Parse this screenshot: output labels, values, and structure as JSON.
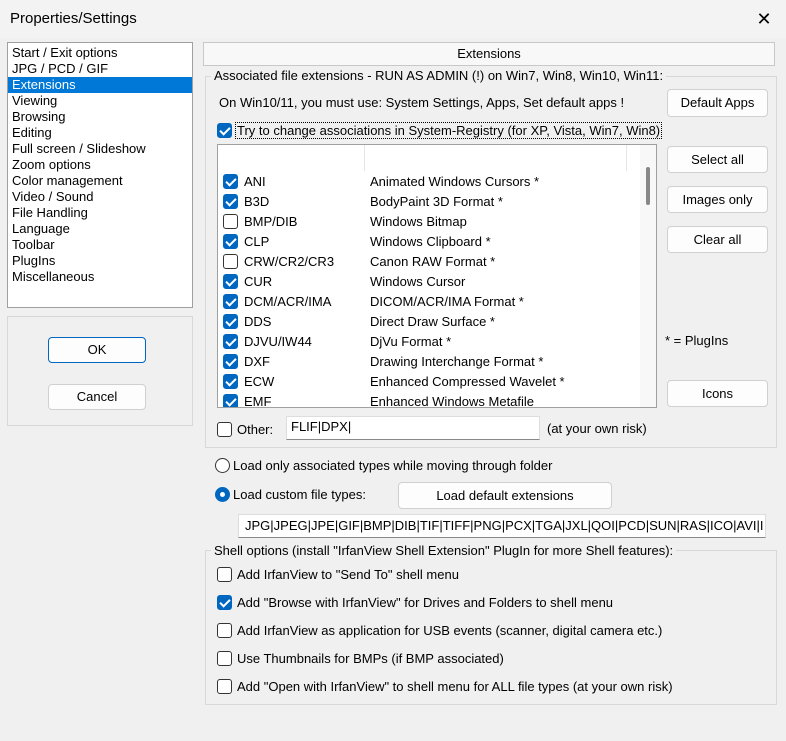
{
  "window": {
    "title": "Properties/Settings",
    "close_icon": "close-icon"
  },
  "sidebar": {
    "items": [
      "Start / Exit options",
      "JPG / PCD / GIF",
      "Extensions",
      "Viewing",
      "Browsing",
      "Editing",
      "Full screen / Slideshow",
      "Zoom options",
      "Color management",
      "Video / Sound",
      "File Handling",
      "Language",
      "Toolbar",
      "PlugIns",
      "Miscellaneous"
    ],
    "selected": "Extensions"
  },
  "buttons": {
    "ok": "OK",
    "cancel": "Cancel",
    "default_apps": "Default Apps",
    "select_all": "Select all",
    "images_only": "Images only",
    "clear_all": "Clear all",
    "icons": "Icons",
    "load_default": "Load default extensions"
  },
  "tab": {
    "title": "Extensions"
  },
  "assoc": {
    "group_label": "Associated file extensions - RUN AS ADMIN (!) on Win7, Win8, Win10, Win11:",
    "note": "On Win10/11, you must use: System Settings, Apps, Set default apps !",
    "registry_label": "Try to change associations in System-Registry (for XP, Vista, Win7, Win8)",
    "registry_checked": true,
    "extensions": [
      {
        "ext": "ANI",
        "desc": "Animated Windows Cursors *",
        "checked": true
      },
      {
        "ext": "B3D",
        "desc": "BodyPaint 3D Format *",
        "checked": true
      },
      {
        "ext": "BMP/DIB",
        "desc": "Windows Bitmap",
        "checked": false
      },
      {
        "ext": "CLP",
        "desc": "Windows Clipboard *",
        "checked": true
      },
      {
        "ext": "CRW/CR2/CR3",
        "desc": "Canon RAW Format *",
        "checked": false
      },
      {
        "ext": "CUR",
        "desc": "Windows Cursor",
        "checked": true
      },
      {
        "ext": "DCM/ACR/IMA",
        "desc": "DICOM/ACR/IMA Format *",
        "checked": true
      },
      {
        "ext": "DDS",
        "desc": "Direct Draw Surface *",
        "checked": true
      },
      {
        "ext": "DJVU/IW44",
        "desc": "DjVu Format *",
        "checked": true
      },
      {
        "ext": "DXF",
        "desc": "Drawing Interchange Format *",
        "checked": true
      },
      {
        "ext": "ECW",
        "desc": "Enhanced Compressed Wavelet *",
        "checked": true
      },
      {
        "ext": "EMF",
        "desc": "Enhanced Windows Metafile",
        "checked": true
      }
    ],
    "plugins_note": "* = PlugIns",
    "other_label": "Other:",
    "other_checked": false,
    "other_value": "FLIF|DPX|",
    "other_note": "(at your own risk)"
  },
  "load": {
    "option1": "Load only associated types while moving through folder",
    "option2": "Load custom file types:",
    "selected": 2,
    "custom_value": "JPG|JPEG|JPE|GIF|BMP|DIB|TIF|TIFF|PNG|PCX|TGA|JXL|QOI|PCD|SUN|RAS|ICO|AVI|I"
  },
  "shell": {
    "group_label": "Shell options (install \"IrfanView Shell Extension\" PlugIn for more Shell features):",
    "options": [
      {
        "label": "Add IrfanView to \"Send To\" shell menu",
        "checked": false
      },
      {
        "label": "Add \"Browse with IrfanView\" for Drives and Folders to shell menu",
        "checked": true
      },
      {
        "label": "Add IrfanView as application for USB events (scanner, digital camera etc.)",
        "checked": false
      },
      {
        "label": "Use Thumbnails for BMPs (if BMP associated)",
        "checked": false
      },
      {
        "label": "Add \"Open with IrfanView\" to shell menu for ALL file types (at your own risk)",
        "checked": false
      }
    ]
  }
}
